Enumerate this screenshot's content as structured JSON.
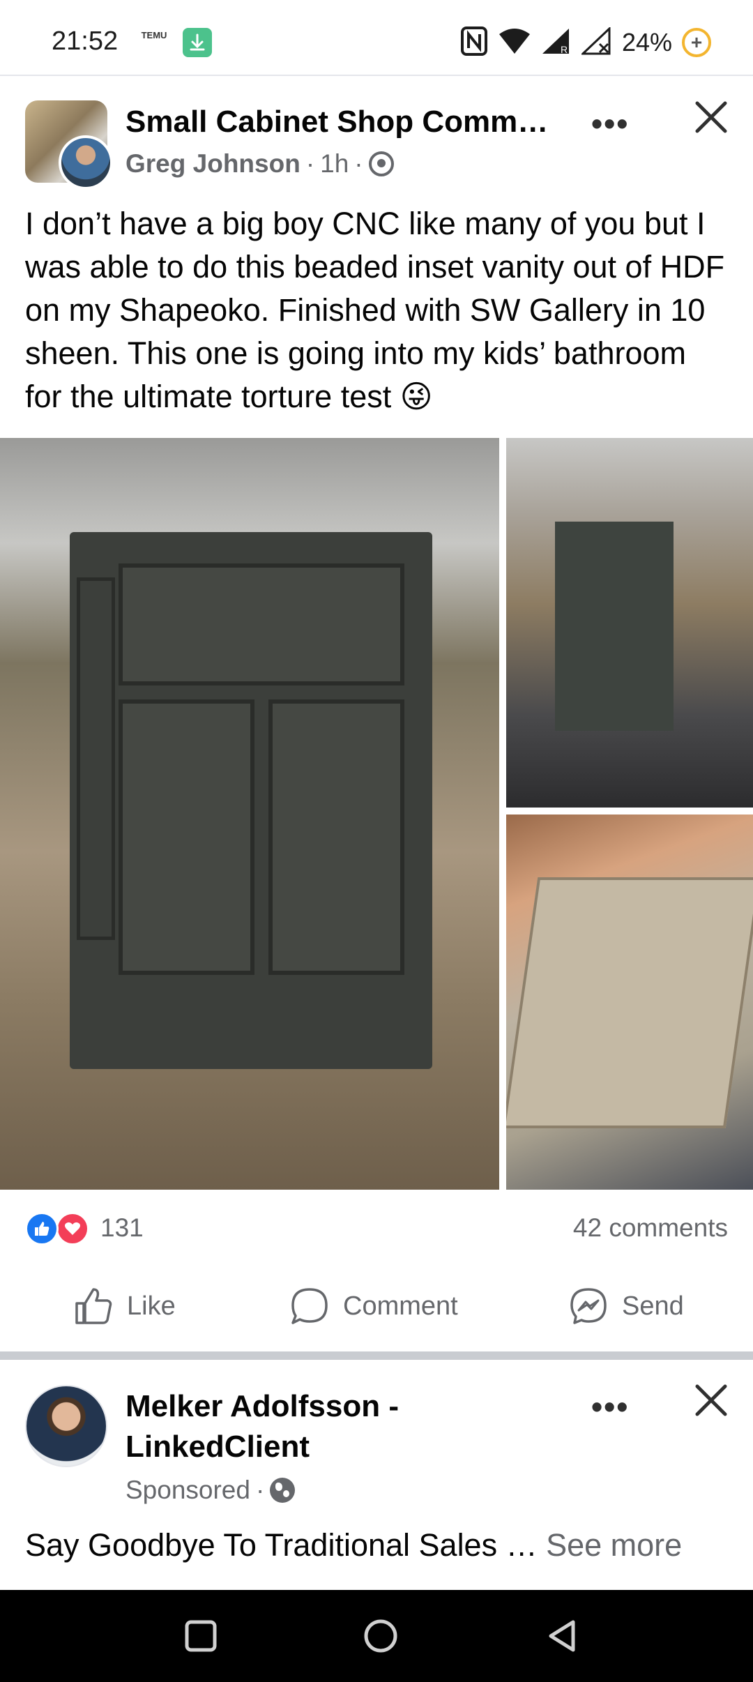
{
  "status_bar": {
    "time": "21:52",
    "temu_label": "TEMU",
    "battery": "24%",
    "battery_symbol": "+"
  },
  "post": {
    "group_name": "Small Cabinet Shop Comm…",
    "author": "Greg Johnson",
    "time": "1h",
    "more_label": "•••",
    "text": "I don’t have a big boy CNC like many of you but I was able to do this beaded inset vanity out of HDF on my Shapeoko. Finished with SW Gallery in 10 sheen. This one is going into my kids’ bathroom for the ultimate torture test 😜",
    "reaction_count": "131",
    "comment_count": "42 comments",
    "actions": {
      "like": "Like",
      "comment": "Comment",
      "send": "Send"
    }
  },
  "sponsored_post": {
    "advertiser": "Melker Adolfsson - LinkedClient",
    "sponsored_label": "Sponsored",
    "more_label": "•••",
    "text": "Say Goodbye To Traditional Sales … ",
    "see_more": "See more"
  },
  "colors": {
    "facebook_blue": "#1877f2",
    "love_red": "#f33e58",
    "secondary_text": "#65676b"
  },
  "icons": [
    "download-icon",
    "nfc-icon",
    "wifi-icon",
    "signal-icon",
    "battery-icon",
    "group-icon",
    "close-icon",
    "like-icon",
    "comment-icon",
    "messenger-icon",
    "globe-icon",
    "recent-apps-icon",
    "home-icon",
    "back-icon"
  ]
}
